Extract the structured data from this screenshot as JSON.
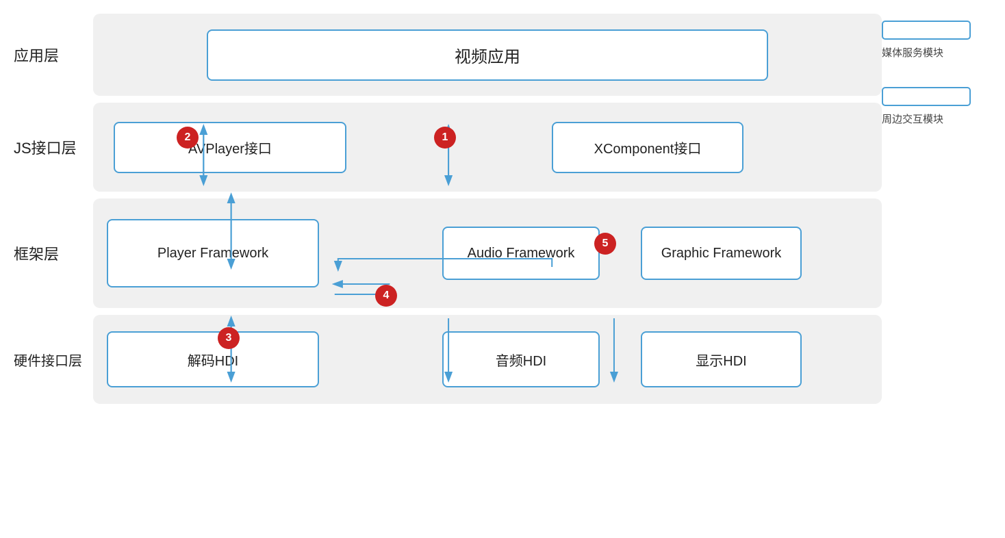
{
  "legend": {
    "media_service_box_label": "",
    "media_service_label": "媒体服务模块",
    "peripheral_box_label": "",
    "peripheral_label": "周边交互模块"
  },
  "layers": {
    "app": {
      "label": "应用层",
      "video_app": "视频应用"
    },
    "js": {
      "label": "JS接口层",
      "avplayer": "AVPlayer接口",
      "xcomponent": "XComponent接口"
    },
    "framework": {
      "label": "框架层",
      "player_fw": "Player Framework",
      "audio_fw": "Audio Framework",
      "graphic_fw": "Graphic Framework"
    },
    "hardware": {
      "label": "硬件接口层",
      "decode_hdi": "解码HDI",
      "audio_hdi": "音频HDI",
      "display_hdi": "显示HDI"
    }
  },
  "badges": [
    "1",
    "2",
    "3",
    "4",
    "5"
  ],
  "colors": {
    "box_border": "#4a9fd5",
    "badge_bg": "#cc2222",
    "layer_bg": "#f0f0f0"
  }
}
